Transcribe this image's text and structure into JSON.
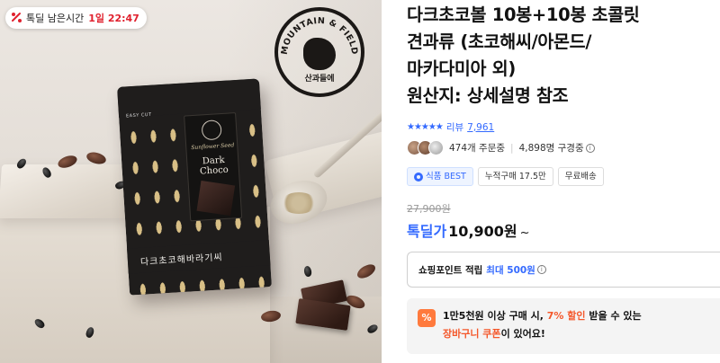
{
  "timer": {
    "label": "톡딜 남은시간",
    "value": "1일 22:47",
    "icon": "percent-tag-icon"
  },
  "product_image": {
    "brand_seal_text": "MOUNTAIN & FIELD",
    "brand_seal_korean": "산과들에",
    "package_easy_cut": "EASY CUT",
    "package_script": "Sunflower Seed",
    "package_name_line1": "Dark",
    "package_name_line2": "Choco",
    "package_korean_name": "다크초코해바라기씨"
  },
  "product": {
    "title_lines": [
      "다크초코볼 10봉+10봉 초콜릿",
      "견과류 (초코해씨/아몬드/",
      "마카다미아 외)",
      "원산지: 상세설명 참조"
    ]
  },
  "rating": {
    "stars": "★★★★★",
    "review_label": "리뷰",
    "review_count": "7,961",
    "accent_color": "#346aff"
  },
  "stats": {
    "orders": "474개 주문중",
    "purchasers": "4,898명 구경중"
  },
  "badges": [
    {
      "label": "식품 BEST"
    },
    {
      "label": "누적구매 17.5만"
    },
    {
      "label": "무료배송"
    }
  ],
  "price": {
    "original": "27,900원",
    "sale_label": "톡딜가",
    "sale_value": "10,900원",
    "chevron": "~"
  },
  "points": {
    "label": "쇼핑포인트 적립",
    "value": "최대 500원"
  },
  "promo": {
    "icon_label": "%",
    "line1_prefix": "1만5천원 이상 구매 시,",
    "line1_highlight": "7% 할인",
    "line1_suffix": "받을 수 있는",
    "line2_highlight": "장바구니 쿠폰",
    "line2_suffix": "이 있어요!",
    "highlight_color": "#f4572a"
  }
}
